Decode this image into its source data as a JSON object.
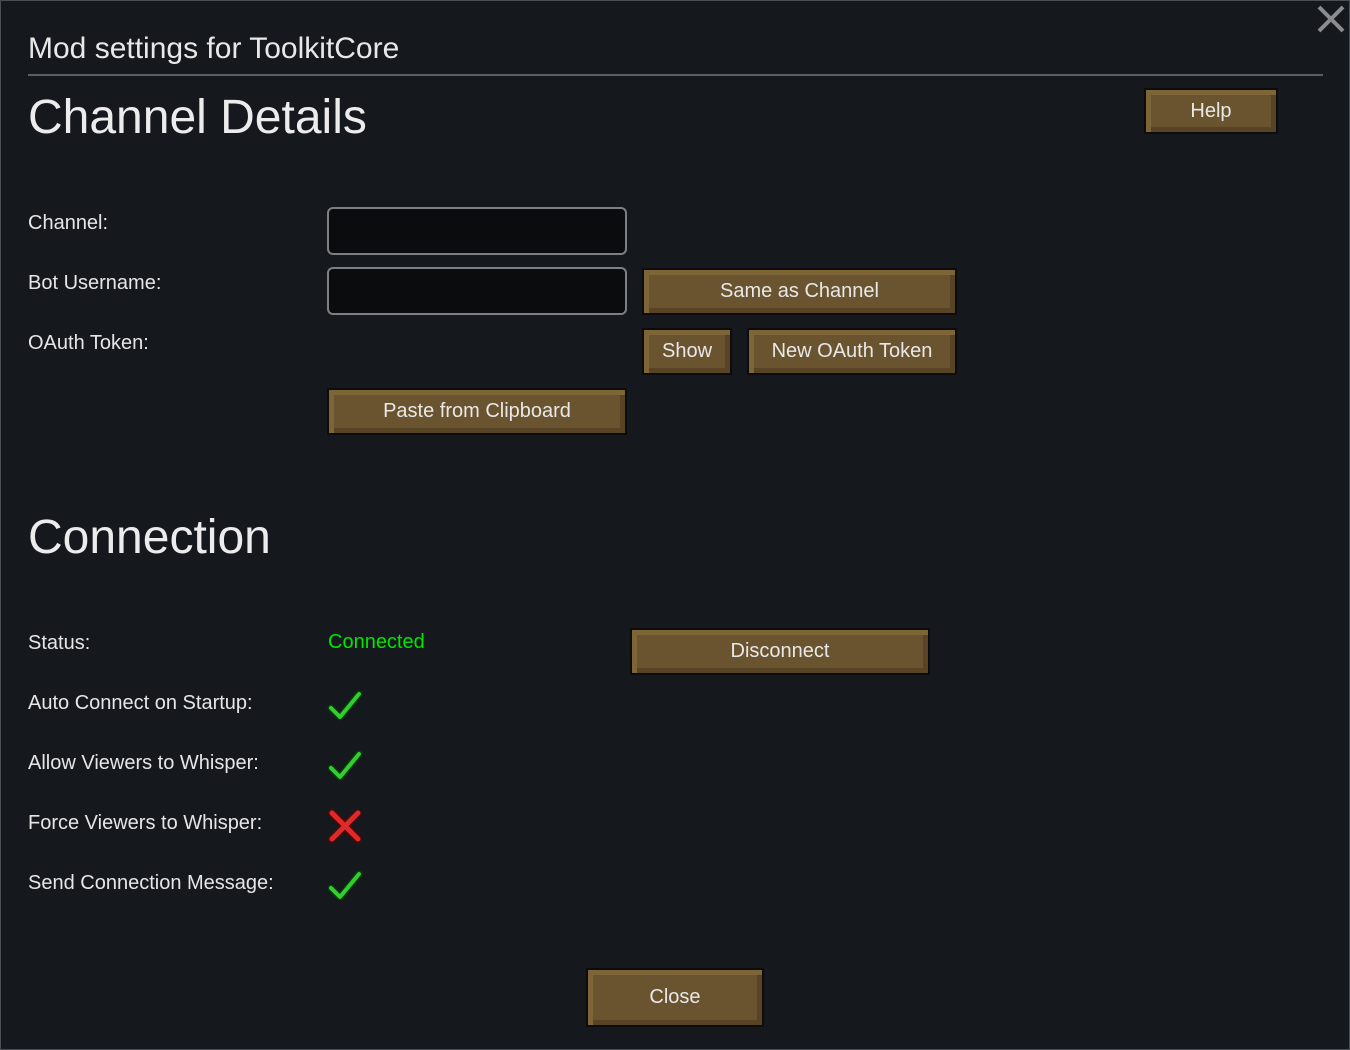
{
  "window": {
    "title": "Mod settings for ToolkitCore",
    "close_icon": "close-x-icon"
  },
  "channel_details": {
    "heading": "Channel Details",
    "help_label": "Help",
    "channel_label": "Channel:",
    "channel_value": "",
    "bot_username_label": "Bot Username:",
    "bot_username_value": "",
    "same_as_channel_label": "Same as Channel",
    "oauth_label": "OAuth Token:",
    "show_label": "Show",
    "new_oauth_label": "New OAuth Token",
    "paste_label": "Paste from Clipboard"
  },
  "connection": {
    "heading": "Connection",
    "status_label": "Status:",
    "status_value": "Connected",
    "status_color": "#00e600",
    "disconnect_label": "Disconnect",
    "options": [
      {
        "label": "Auto Connect on Startup:",
        "checked": true
      },
      {
        "label": "Allow Viewers to Whisper:",
        "checked": true
      },
      {
        "label": "Force Viewers to Whisper:",
        "checked": false
      },
      {
        "label": "Send Connection Message:",
        "checked": true
      }
    ]
  },
  "footer": {
    "close_label": "Close"
  },
  "colors": {
    "background": "#15181d",
    "button": "#6a5430",
    "check": "#2fcf2f",
    "cross": "#e02a2a"
  }
}
